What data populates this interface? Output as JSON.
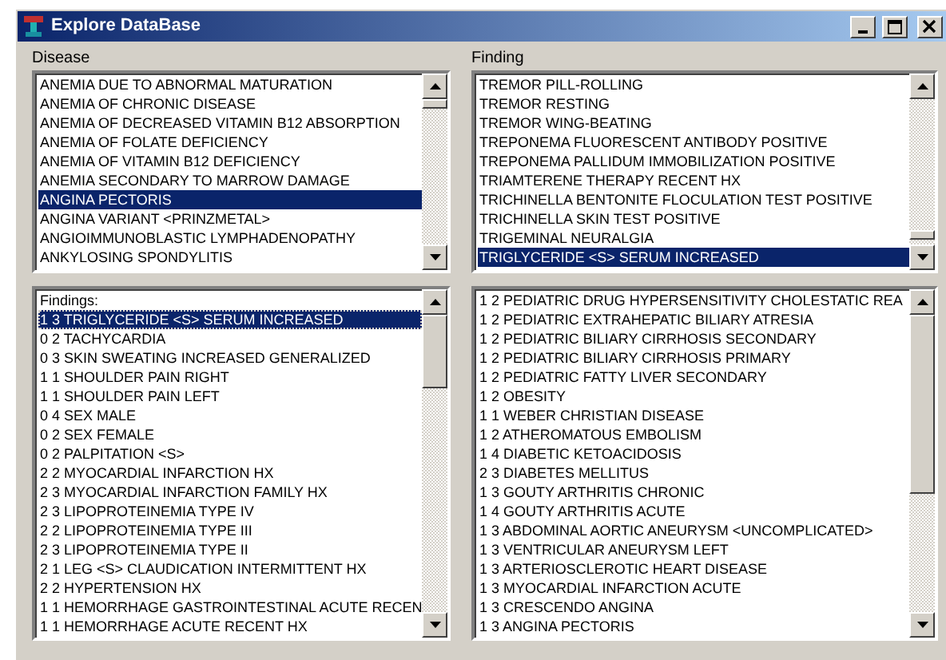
{
  "window": {
    "title": "Explore DataBase"
  },
  "disease": {
    "label": "Disease",
    "items": [
      {
        "text": "ANEMIA DUE TO ABNORMAL MATURATION",
        "selected": false
      },
      {
        "text": "ANEMIA OF CHRONIC DISEASE",
        "selected": false
      },
      {
        "text": "ANEMIA OF DECREASED VITAMIN B12 ABSORPTION",
        "selected": false
      },
      {
        "text": "ANEMIA OF FOLATE DEFICIENCY",
        "selected": false
      },
      {
        "text": "ANEMIA OF VITAMIN B12 DEFICIENCY",
        "selected": false
      },
      {
        "text": "ANEMIA SECONDARY TO MARROW DAMAGE",
        "selected": false
      },
      {
        "text": "ANGINA PECTORIS",
        "selected": true
      },
      {
        "text": "ANGINA VARIANT <PRINZMETAL>",
        "selected": false
      },
      {
        "text": "ANGIOIMMUNOBLASTIC LYMPHADENOPATHY",
        "selected": false
      },
      {
        "text": "ANKYLOSING SPONDYLITIS",
        "selected": false
      }
    ]
  },
  "finding": {
    "label": "Finding",
    "items": [
      {
        "text": "TREMOR PILL-ROLLING",
        "selected": false
      },
      {
        "text": "TREMOR RESTING",
        "selected": false
      },
      {
        "text": "TREMOR WING-BEATING",
        "selected": false
      },
      {
        "text": "TREPONEMA FLUORESCENT ANTIBODY POSITIVE",
        "selected": false
      },
      {
        "text": "TREPONEMA PALLIDUM IMMOBILIZATION POSITIVE",
        "selected": false
      },
      {
        "text": "TRIAMTERENE THERAPY RECENT HX",
        "selected": false
      },
      {
        "text": "TRICHINELLA BENTONITE FLOCULATION TEST POSITIVE",
        "selected": false
      },
      {
        "text": "TRICHINELLA SKIN TEST POSITIVE",
        "selected": false
      },
      {
        "text": "TRIGEMINAL NEURALGIA",
        "selected": false
      },
      {
        "text": "TRIGLYCERIDE <S> SERUM INCREASED",
        "selected": true
      }
    ]
  },
  "disease_findings": {
    "items": [
      {
        "text": "Findings:",
        "selected": false
      },
      {
        "text": "1 3 TRIGLYCERIDE <S> SERUM INCREASED",
        "selected": true
      },
      {
        "text": "0 2 TACHYCARDIA",
        "selected": false
      },
      {
        "text": "0 3 SKIN SWEATING INCREASED GENERALIZED",
        "selected": false
      },
      {
        "text": "1 1 SHOULDER PAIN RIGHT",
        "selected": false
      },
      {
        "text": "1 1 SHOULDER PAIN LEFT",
        "selected": false
      },
      {
        "text": "0 4 SEX MALE",
        "selected": false
      },
      {
        "text": "0 2 SEX FEMALE",
        "selected": false
      },
      {
        "text": "0 2 PALPITATION <S>",
        "selected": false
      },
      {
        "text": "2 2 MYOCARDIAL INFARCTION HX",
        "selected": false
      },
      {
        "text": "2 3 MYOCARDIAL INFARCTION FAMILY HX",
        "selected": false
      },
      {
        "text": "2 3 LIPOPROTEINEMIA TYPE IV",
        "selected": false
      },
      {
        "text": "2 2 LIPOPROTEINEMIA TYPE III",
        "selected": false
      },
      {
        "text": "2 3 LIPOPROTEINEMIA TYPE II",
        "selected": false
      },
      {
        "text": "2 1 LEG <S> CLAUDICATION INTERMITTENT HX",
        "selected": false
      },
      {
        "text": "2 2 HYPERTENSION HX",
        "selected": false
      },
      {
        "text": "1 1 HEMORRHAGE GASTROINTESTINAL ACUTE RECEN",
        "selected": false
      },
      {
        "text": "1 1 HEMORRHAGE ACUTE RECENT HX",
        "selected": false
      }
    ]
  },
  "finding_diseases": {
    "items": [
      {
        "text": "1 2 PEDIATRIC DRUG HYPERSENSITIVITY CHOLESTATIC REA",
        "selected": false
      },
      {
        "text": "1 2 PEDIATRIC EXTRAHEPATIC BILIARY ATRESIA",
        "selected": false
      },
      {
        "text": "1 2 PEDIATRIC BILIARY CIRRHOSIS SECONDARY",
        "selected": false
      },
      {
        "text": "1 2 PEDIATRIC BILIARY CIRRHOSIS PRIMARY",
        "selected": false
      },
      {
        "text": "1 2 PEDIATRIC FATTY LIVER SECONDARY",
        "selected": false
      },
      {
        "text": "1 2 OBESITY",
        "selected": false
      },
      {
        "text": "1 1 WEBER CHRISTIAN DISEASE",
        "selected": false
      },
      {
        "text": "1 2 ATHEROMATOUS EMBOLISM",
        "selected": false
      },
      {
        "text": "1 4 DIABETIC KETOACIDOSIS",
        "selected": false
      },
      {
        "text": "2 3 DIABETES MELLITUS",
        "selected": false
      },
      {
        "text": "1 3 GOUTY ARTHRITIS CHRONIC",
        "selected": false
      },
      {
        "text": "1 4 GOUTY ARTHRITIS ACUTE",
        "selected": false
      },
      {
        "text": "1 3 ABDOMINAL AORTIC ANEURYSM <UNCOMPLICATED>",
        "selected": false
      },
      {
        "text": "1 3 VENTRICULAR ANEURYSM LEFT",
        "selected": false
      },
      {
        "text": "1 3 ARTERIOSCLEROTIC HEART DISEASE",
        "selected": false
      },
      {
        "text": "1 3 MYOCARDIAL INFARCTION ACUTE",
        "selected": false
      },
      {
        "text": "1 3 CRESCENDO ANGINA",
        "selected": false
      },
      {
        "text": "1 3 ANGINA PECTORIS",
        "selected": false
      }
    ]
  }
}
